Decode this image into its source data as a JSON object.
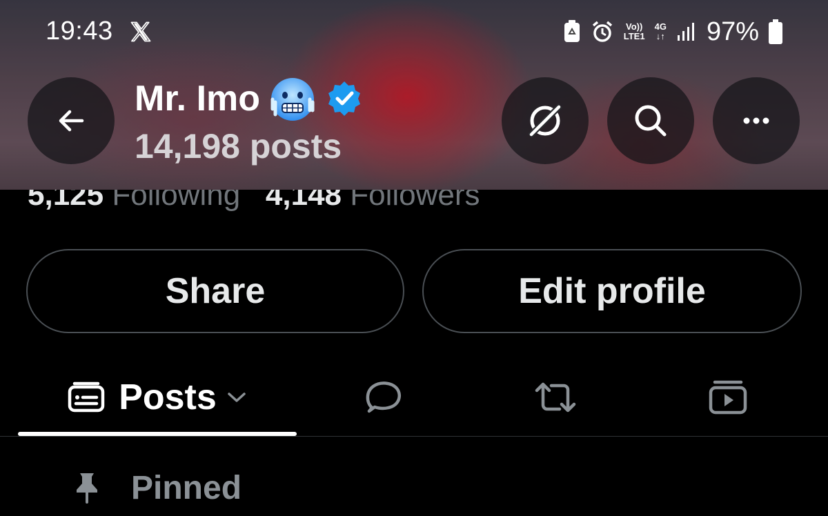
{
  "status_bar": {
    "time": "19:43",
    "network_volte": "Vo))",
    "network_lte": "LTE1",
    "network_gen": "4G",
    "battery": "97%"
  },
  "header": {
    "profile_name": "Mr. Imo",
    "post_count": "14,198 posts",
    "name_emoji": "cold-face-emoji",
    "verified_color": "#1d9bf0"
  },
  "stats": {
    "following_count": "5,125",
    "following_label": "Following",
    "followers_count": "4,148",
    "followers_label": "Followers"
  },
  "actions": {
    "share_label": "Share",
    "edit_label": "Edit profile"
  },
  "tabs": {
    "posts_label": "Posts",
    "icons": [
      "posts-icon",
      "replies-icon",
      "reposts-icon",
      "media-icon"
    ]
  },
  "pinned": {
    "label": "Pinned"
  }
}
